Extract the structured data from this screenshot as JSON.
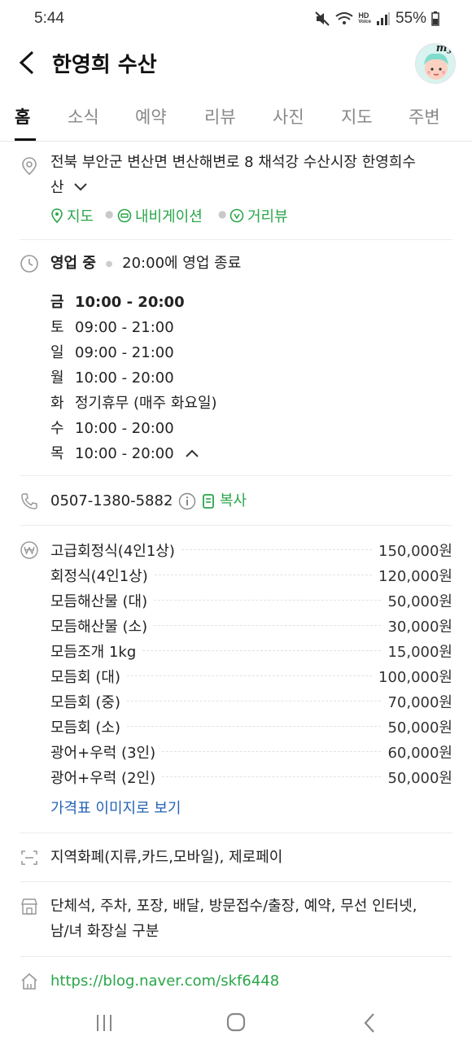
{
  "status_bar": {
    "time": "5:44",
    "hd_label": "HD",
    "voice_label": "Voice",
    "battery": "55%"
  },
  "header": {
    "title": "한영희 수산",
    "avatar_badge": "my"
  },
  "tabs": [
    {
      "label": "홈",
      "active": true
    },
    {
      "label": "소식"
    },
    {
      "label": "예약"
    },
    {
      "label": "리뷰"
    },
    {
      "label": "사진"
    },
    {
      "label": "지도"
    },
    {
      "label": "주변"
    }
  ],
  "address": {
    "line1": "전북 부안군 변산면 변산해변로 8 채석강 수산시장 한영희수",
    "line2": "산",
    "links": {
      "map": "지도",
      "navigation": "내비게이션",
      "streetview": "거리뷰"
    }
  },
  "hours": {
    "status": "영업 중",
    "closing": "20:00에 영업 종료",
    "days": [
      {
        "day": "금",
        "time": "10:00 - 20:00",
        "today": true
      },
      {
        "day": "토",
        "time": "09:00 - 21:00"
      },
      {
        "day": "일",
        "time": "09:00 - 21:00"
      },
      {
        "day": "월",
        "time": "10:00 - 20:00"
      },
      {
        "day": "화",
        "time": "정기휴무 (매주 화요일)"
      },
      {
        "day": "수",
        "time": "10:00 - 20:00"
      },
      {
        "day": "목",
        "time": "10:00 - 20:00"
      }
    ]
  },
  "phone": {
    "number": "0507-1380-5882",
    "copy_label": "복사"
  },
  "menu": {
    "items": [
      {
        "name": "고급회정식(4인1상)",
        "price": "150,000원"
      },
      {
        "name": "회정식(4인1상)",
        "price": "120,000원"
      },
      {
        "name": "모듬해산물 (대)",
        "price": "50,000원"
      },
      {
        "name": "모듬해산물 (소)",
        "price": "30,000원"
      },
      {
        "name": "모듬조개 1kg",
        "price": "15,000원"
      },
      {
        "name": "모듬회 (대)",
        "price": "100,000원"
      },
      {
        "name": "모듬회 (중)",
        "price": "70,000원"
      },
      {
        "name": "모듬회 (소)",
        "price": "50,000원"
      },
      {
        "name": "광어+우럭 (3인)",
        "price": "60,000원"
      },
      {
        "name": "광어+우럭 (2인)",
        "price": "50,000원"
      }
    ],
    "image_link": "가격표 이미지로 보기"
  },
  "payment": {
    "text": "지역화폐(지류,카드,모바일), 제로페이"
  },
  "facilities": {
    "line1": "단체석, 주차, 포장, 배달, 방문접수/출장, 예약, 무선 인터넷,",
    "line2": "남/녀 화장실 구분"
  },
  "website": {
    "url": "https://blog.naver.com/skf6448"
  },
  "colors": {
    "accent_green": "#2aa64a",
    "link_blue": "#2563b5"
  }
}
